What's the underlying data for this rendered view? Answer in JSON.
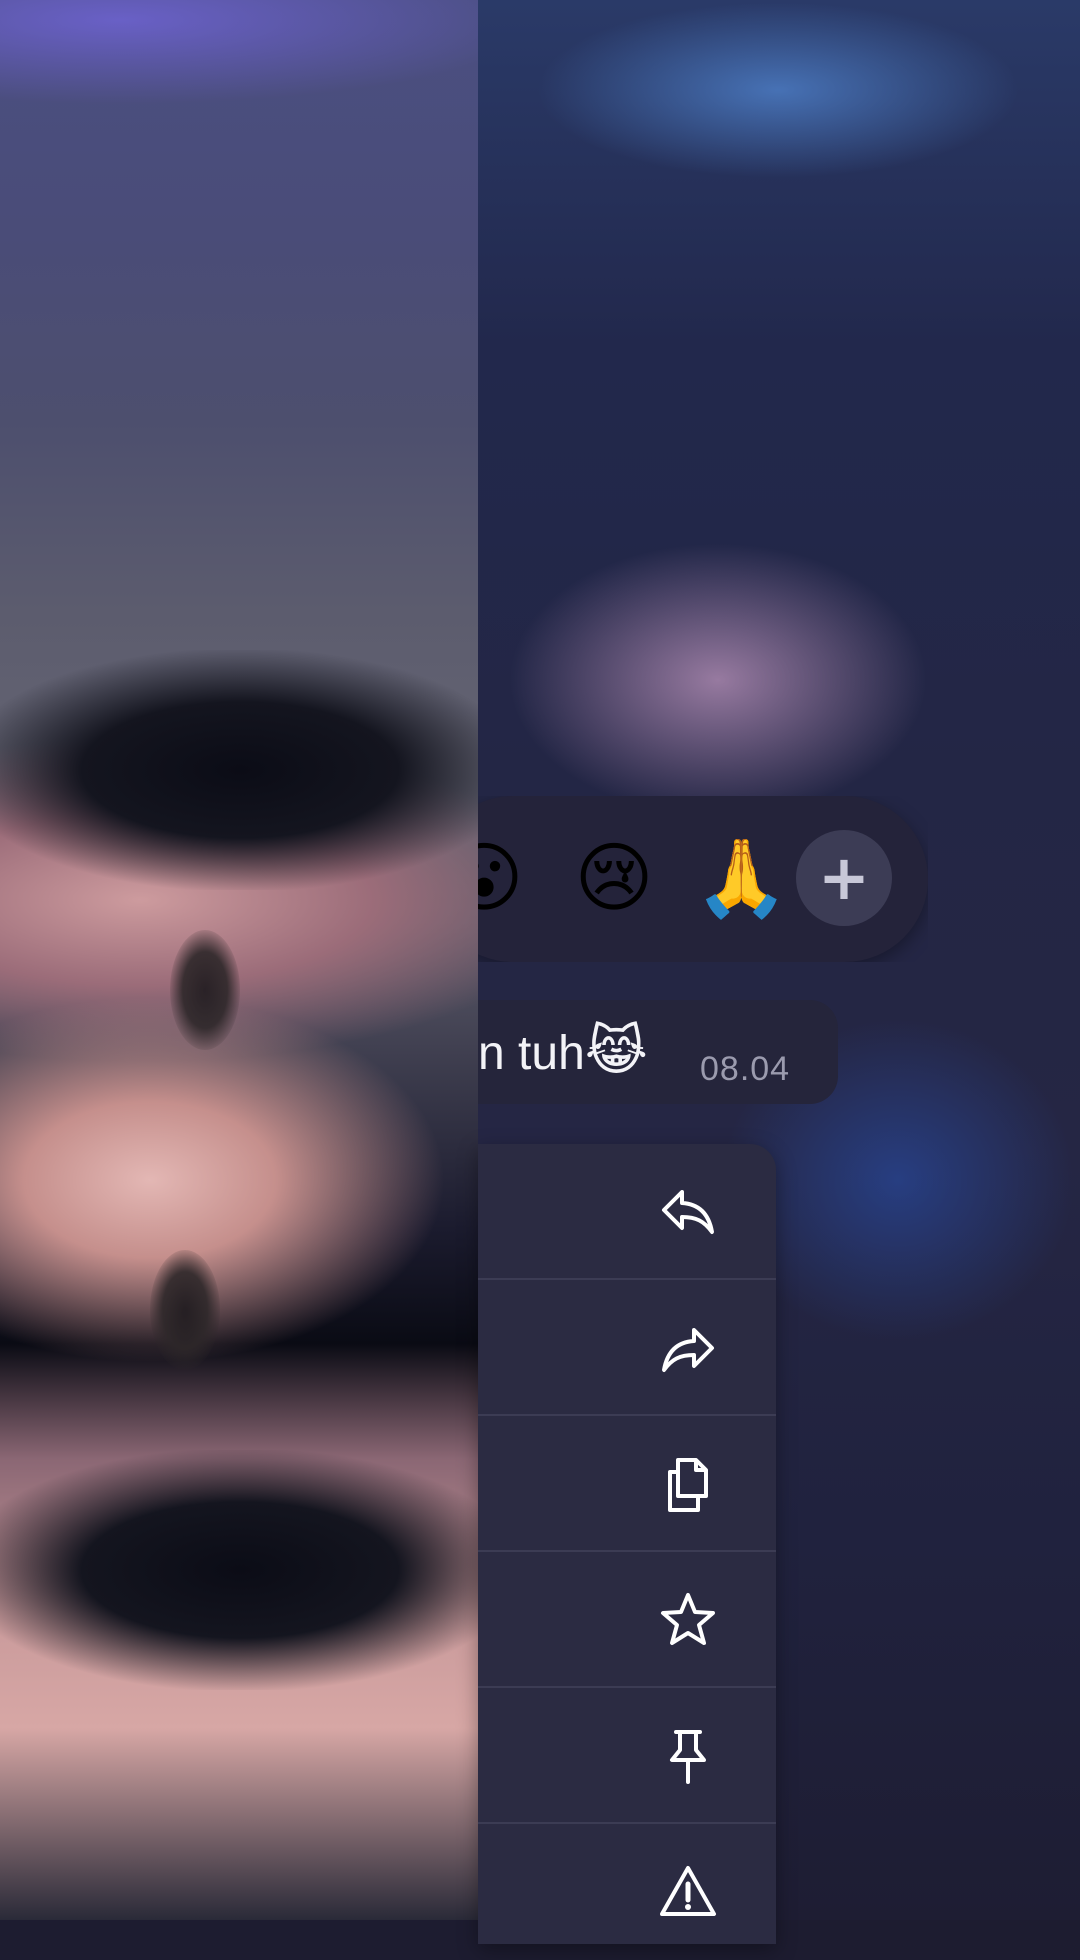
{
  "screen": {
    "photo": {
      "description_icon": "selfie-photo"
    }
  },
  "reactions": {
    "items": [
      {
        "emoji": "😮",
        "name": "surprised-emoji"
      },
      {
        "emoji": "😢",
        "name": "crying-emoji"
      },
      {
        "emoji": "🙏",
        "name": "folded-hands-emoji"
      }
    ],
    "more_label": "+"
  },
  "message": {
    "text": "n tuh",
    "emoji": "😹",
    "time": "08.04"
  },
  "actions": {
    "items": [
      {
        "label": "",
        "icon": "reply-icon"
      },
      {
        "label": "",
        "icon": "forward-icon"
      },
      {
        "label": "",
        "icon": "copy-icon"
      },
      {
        "label": "",
        "icon": "star-icon"
      },
      {
        "label": "",
        "icon": "pin-icon"
      },
      {
        "label": "",
        "icon": "report-icon"
      }
    ]
  },
  "colors": {
    "menu_background": "#2b2b42",
    "icon_color": "#ffffff",
    "time_color": "#9b9bae"
  }
}
